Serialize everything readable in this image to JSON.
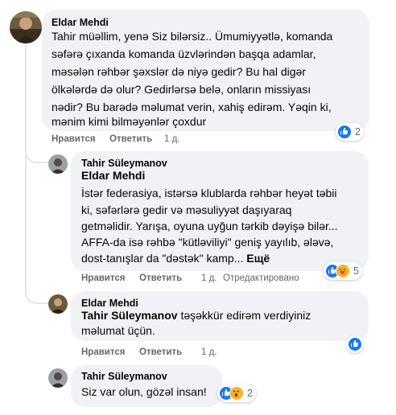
{
  "comments": [
    {
      "author": "Eldar Mehdi",
      "avatar_icon": "profile-photo-eldar",
      "lines": [
        "Tahir müəllim, yenə Siz bilərsiz.. Ümumiyyətlə, komanda",
        "səfərə çıxanda komanda üzvlərindən başqa adamlar,",
        "məsələn rəhbər şəxslər də niyə gedir? Bu hal digər",
        "ölkələrdə də olur? Gedirlərsə belə, onların missiyası",
        "nədir? Bu barədə məlumat verin, xahiş edirəm. Yəqin ki,",
        "mənim kimi bilməyənlər çoxdur"
      ],
      "like_label": "Нравится",
      "reply_label": "Ответить",
      "time": "1 д.",
      "reactions": [
        "like"
      ],
      "reaction_count": "2"
    },
    {
      "author": "Tahir Süleymanov",
      "avatar_icon": "profile-photo-tahir",
      "mention": "Eldar Mehdi",
      "lines": [
        "İstər federasiya, istərsə klublarda rəhbər heyət təbii",
        "ki, səfərlərə gedir və məsuliyyət daşıyaraq",
        "getməlidir. Yarışa, oyuna uyğun tərkib dəyişə bilər...",
        "AFFA-da isə rəhbə \"kütləviliyi\" geniş yayılıb, ələvə,",
        "dost-tanışlar da \"dəstək\" kamp..."
      ],
      "more_label": "Ещё",
      "like_label": "Нравится",
      "reply_label": "Ответить",
      "time": "1 д.",
      "edited_label": "Отредактировано",
      "reactions": [
        "like",
        "care"
      ],
      "reaction_count": "5"
    },
    {
      "author": "Eldar Mehdi",
      "avatar_icon": "profile-photo-eldar",
      "mention": "Tahir Süleymanov",
      "first_line_rest": " təşəkkür edirəm verdiyiniz",
      "lines": [
        "məlumat üçün."
      ],
      "like_label": "Нравится",
      "reply_label": "Ответить",
      "time": "1 д.",
      "reactions": [
        "like"
      ],
      "reaction_count": ""
    },
    {
      "author": "Tahir Süleymanov",
      "avatar_icon": "profile-photo-tahir",
      "lines": [
        "Siz var olun, gözəl insan!"
      ],
      "like_label": "Нравится",
      "reply_label": "Ответить",
      "time": "1 д.",
      "reactions": [
        "like",
        "wow"
      ],
      "reaction_count": "2"
    }
  ],
  "colors": {
    "bubble": "#f0f2f5",
    "text": "#050505",
    "secondary": "#65676b",
    "like_blue": "#1877f2",
    "reaction_yellow": "#f7b125"
  }
}
